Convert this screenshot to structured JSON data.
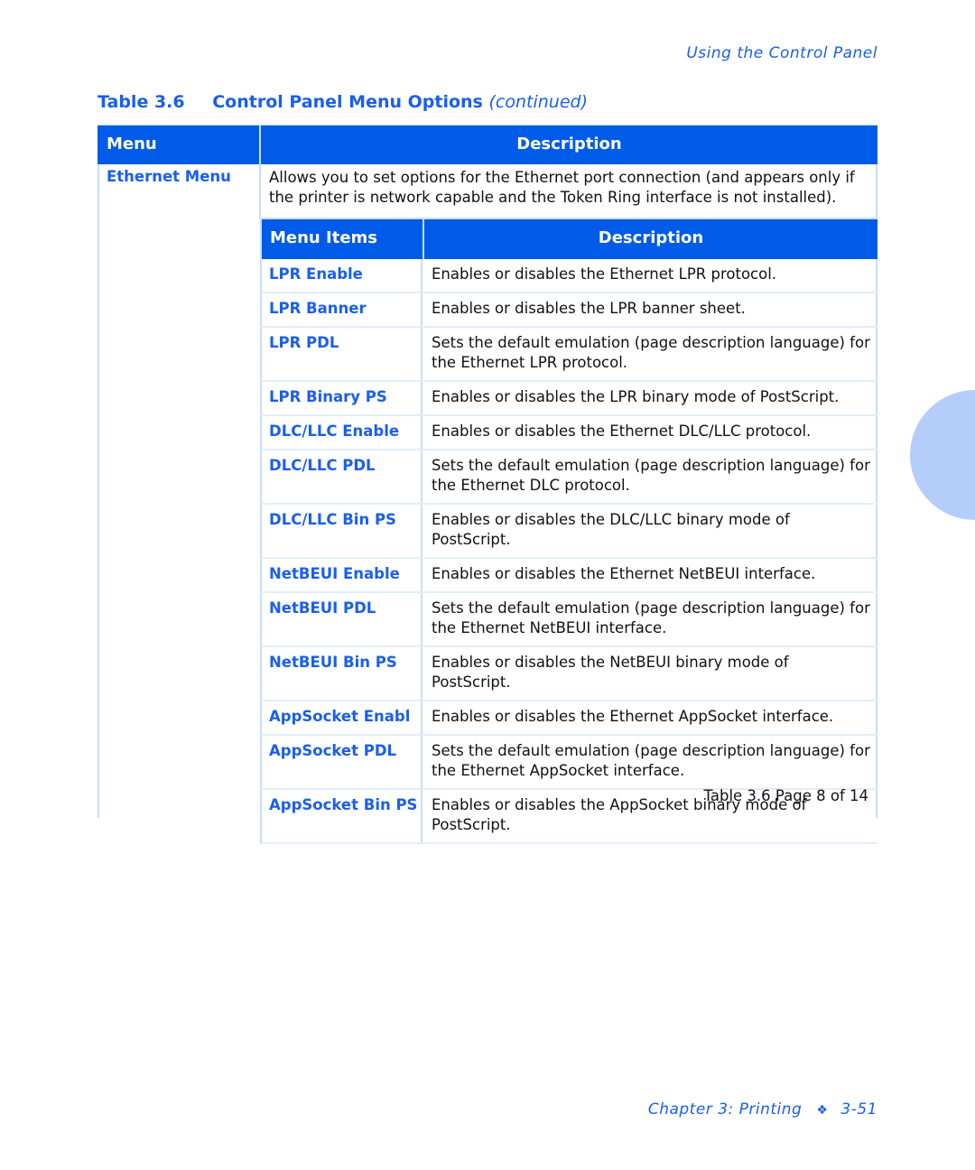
{
  "running_head": "Using the Control Panel",
  "caption": {
    "number": "Table 3.6",
    "title": "Control Panel Menu Options",
    "continued": "(continued)"
  },
  "header": {
    "menu": "Menu",
    "description": "Description"
  },
  "menu": {
    "name": "Ethernet Menu",
    "description": "Allows you to set options for the Ethernet port connection (and appears only if the printer is network capable and the Token Ring interface is not installed)."
  },
  "inner_header": {
    "items": "Menu Items",
    "description": "Description"
  },
  "rows": [
    {
      "item": "LPR Enable",
      "desc": "Enables or disables the Ethernet LPR protocol."
    },
    {
      "item": "LPR Banner",
      "desc": "Enables or disables the LPR banner sheet."
    },
    {
      "item": "LPR PDL",
      "desc": "Sets the default emulation (page description language) for the Ethernet LPR protocol."
    },
    {
      "item": "LPR Binary PS",
      "desc": "Enables or disables the LPR binary mode of PostScript."
    },
    {
      "item": "DLC/LLC Enable",
      "desc": "Enables or disables the Ethernet DLC/LLC protocol."
    },
    {
      "item": "DLC/LLC PDL",
      "desc": "Sets the default emulation (page description language) for the Ethernet DLC protocol."
    },
    {
      "item": "DLC/LLC Bin PS",
      "desc": "Enables or disables the DLC/LLC binary mode of PostScript."
    },
    {
      "item": "NetBEUI Enable",
      "desc": "Enables or disables the Ethernet NetBEUI interface."
    },
    {
      "item": "NetBEUI PDL",
      "desc": "Sets the default emulation (page description language) for the Ethernet NetBEUI interface."
    },
    {
      "item": "NetBEUI Bin PS",
      "desc": "Enables or disables the NetBEUI binary mode of PostScript."
    },
    {
      "item": "AppSocket Enabl",
      "desc": "Enables or disables the Ethernet AppSocket interface."
    },
    {
      "item": "AppSocket PDL",
      "desc": "Sets the default emulation (page description language) for the Ethernet AppSocket interface."
    },
    {
      "item": "AppSocket Bin PS",
      "desc": "Enables or disables the AppSocket binary mode of PostScript."
    }
  ],
  "table_page_note": "Table 3.6  Page 8 of 14",
  "footer": {
    "chapter": "Chapter 3: Printing",
    "separator_icon": "❖",
    "page": "3-51"
  },
  "colors": {
    "accent": "#1a5ef0",
    "header_bg": "#005be9",
    "border": "#c8def6",
    "thumb_tab": "#b5cdfa"
  }
}
